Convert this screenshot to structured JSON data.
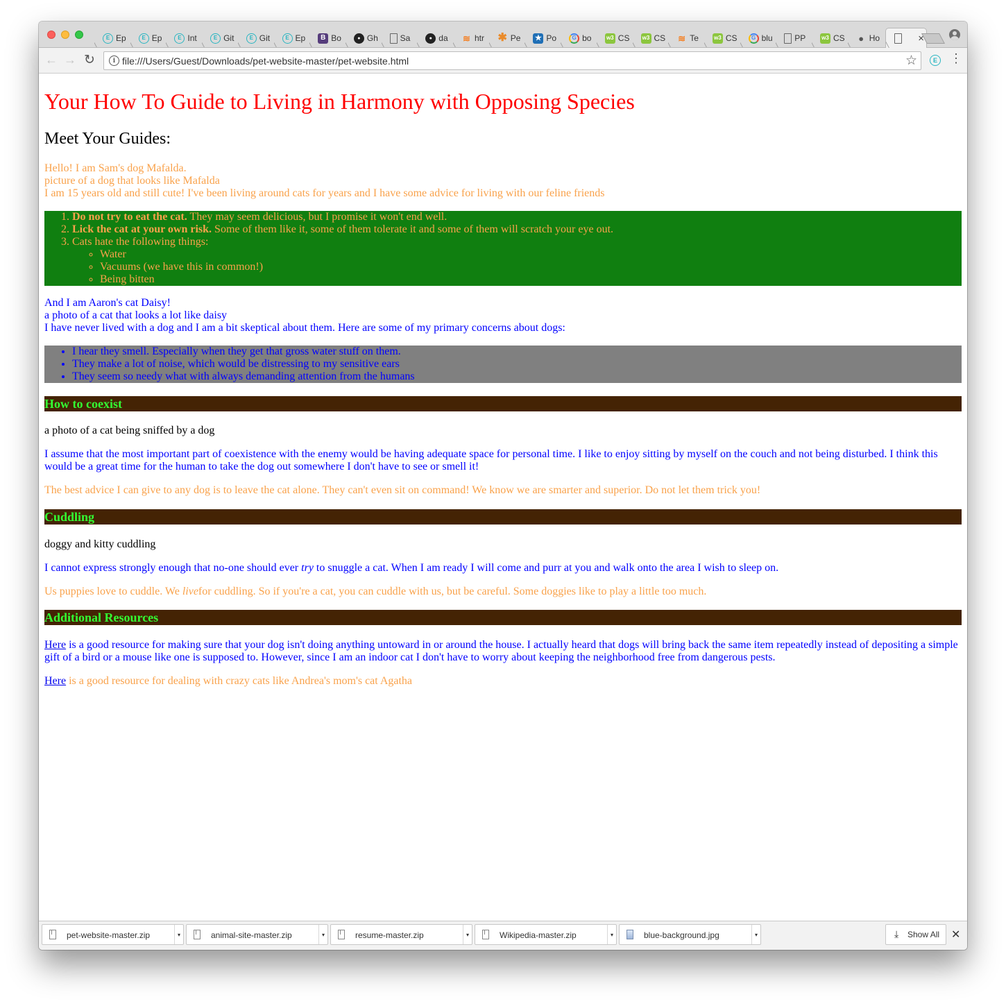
{
  "browser": {
    "tabs": [
      {
        "icon": "e",
        "title": "Ep"
      },
      {
        "icon": "e",
        "title": "Ep"
      },
      {
        "icon": "e",
        "title": "Int"
      },
      {
        "icon": "e",
        "title": "Git"
      },
      {
        "icon": "e",
        "title": "Git"
      },
      {
        "icon": "e",
        "title": "Ep"
      },
      {
        "icon": "bootstrap",
        "title": "Bo"
      },
      {
        "icon": "github",
        "title": "Gh"
      },
      {
        "icon": "doc",
        "title": "Sa"
      },
      {
        "icon": "github",
        "title": "da"
      },
      {
        "icon": "stackoverflow",
        "title": "htr"
      },
      {
        "icon": "star",
        "title": "Pe"
      },
      {
        "icon": "po",
        "title": "Po"
      },
      {
        "icon": "google",
        "title": "bo"
      },
      {
        "icon": "w3",
        "title": "CS"
      },
      {
        "icon": "w3",
        "title": "CS"
      },
      {
        "icon": "stackoverflow",
        "title": "Te"
      },
      {
        "icon": "w3",
        "title": "CS"
      },
      {
        "icon": "google",
        "title": "blu"
      },
      {
        "icon": "doc",
        "title": "PP"
      },
      {
        "icon": "w3",
        "title": "CS"
      },
      {
        "icon": "apple",
        "title": "Ho"
      }
    ],
    "active_tab": {
      "icon": "doc",
      "title": ""
    },
    "url": "file:///Users/Guest/Downloads/pet-website-master/pet-website.html"
  },
  "page": {
    "title": "Your How To Guide to Living in Harmony with Opposing Species",
    "subtitle": "Meet Your Guides:",
    "mafalda": {
      "intro": "Hello! I am Sam's dog Mafalda.",
      "img_alt": "picture of a dog that looks like Mafalda",
      "desc": "I am 15 years old and still cute! I've been living around cats for years and I have some advice for living with our feline friends",
      "tips": [
        {
          "bold": "Do not try to eat the cat.",
          "text": " They may seem delicious, but I promise it won't end well."
        },
        {
          "bold": "Lick the cat at your own risk.",
          "text": " Some of them like it, some of them tolerate it and some of them will scratch your eye out."
        },
        {
          "bold": "",
          "text": "Cats hate the following things:"
        }
      ],
      "hates": [
        "Water",
        "Vacuums (we have this in common!)",
        "Being bitten"
      ]
    },
    "daisy": {
      "intro": "And I am Aaron's cat Daisy!",
      "img_alt": "a photo of a cat that looks a lot like daisy",
      "desc": "I have never lived with a dog and I am a bit skeptical about them. Here are some of my primary concerns about dogs:",
      "concerns": [
        "I hear they smell. Especially when they get that gross water stuff on them.",
        "They make a lot of noise, which would be distressing to my sensitive ears",
        "They seem so needy what with always demanding attention from the humans"
      ]
    },
    "coexist": {
      "heading": "How to coexist",
      "img_alt": "a photo of a cat being sniffed by a dog",
      "cat_text": "I assume that the most important part of coexistence with the enemy would be having adequate space for personal time. I like to enjoy sitting by myself on the couch and not being disturbed. I think this would be a great time for the human to take the dog out somewhere I don't have to see or smell it!",
      "dog_text": "The best advice I can give to any dog is to leave the cat alone. They can't even sit on command! We know we are smarter and superior. Do not let them trick you!"
    },
    "cuddling": {
      "heading": "Cuddling",
      "img_alt": "doggy and kitty cuddling",
      "cat_pre": "I cannot express strongly enough that no-one should ever ",
      "cat_em": "try",
      "cat_post": " to snuggle a cat. When I am ready I will come and purr at you and walk onto the area I wish to sleep on.",
      "dog_pre": "Us puppies love to cuddle. We ",
      "dog_em": "live",
      "dog_post": "for cuddling. So if you're a cat, you can cuddle with us, but be careful. Some doggies like to play a little too much."
    },
    "resources": {
      "heading": "Additional Resources",
      "link1": "Here",
      "text1": " is a good resource for making sure that your dog isn't doing anything untoward in or around the house. I actually heard that dogs will bring back the same item repeatedly instead of depositing a simple gift of a bird or a mouse like one is supposed to. However, since I am an indoor cat I don't have to worry about keeping the neighborhood free from dangerous pests.",
      "link2": "Here",
      "text2": " is a good resource for dealing with crazy cats like Andrea's mom's cat Agatha"
    }
  },
  "downloads": {
    "items": [
      {
        "name": "pet-website-master.zip",
        "icon": "file-icon"
      },
      {
        "name": "animal-site-master.zip",
        "icon": "file-icon"
      },
      {
        "name": "resume-master.zip",
        "icon": "file-icon"
      },
      {
        "name": "Wikipedia-master.zip",
        "icon": "file-icon"
      },
      {
        "name": "blue-background.jpg",
        "icon": "image-file-icon"
      }
    ],
    "show_all": "Show All"
  },
  "colors": {
    "title": "#ff0000",
    "dog_text": "#f9a24b",
    "cat_text": "#0000ff",
    "green_box": "#107f10",
    "gray_box": "#808080",
    "heading_bar": "#442304",
    "heading_text": "#33ff33"
  }
}
